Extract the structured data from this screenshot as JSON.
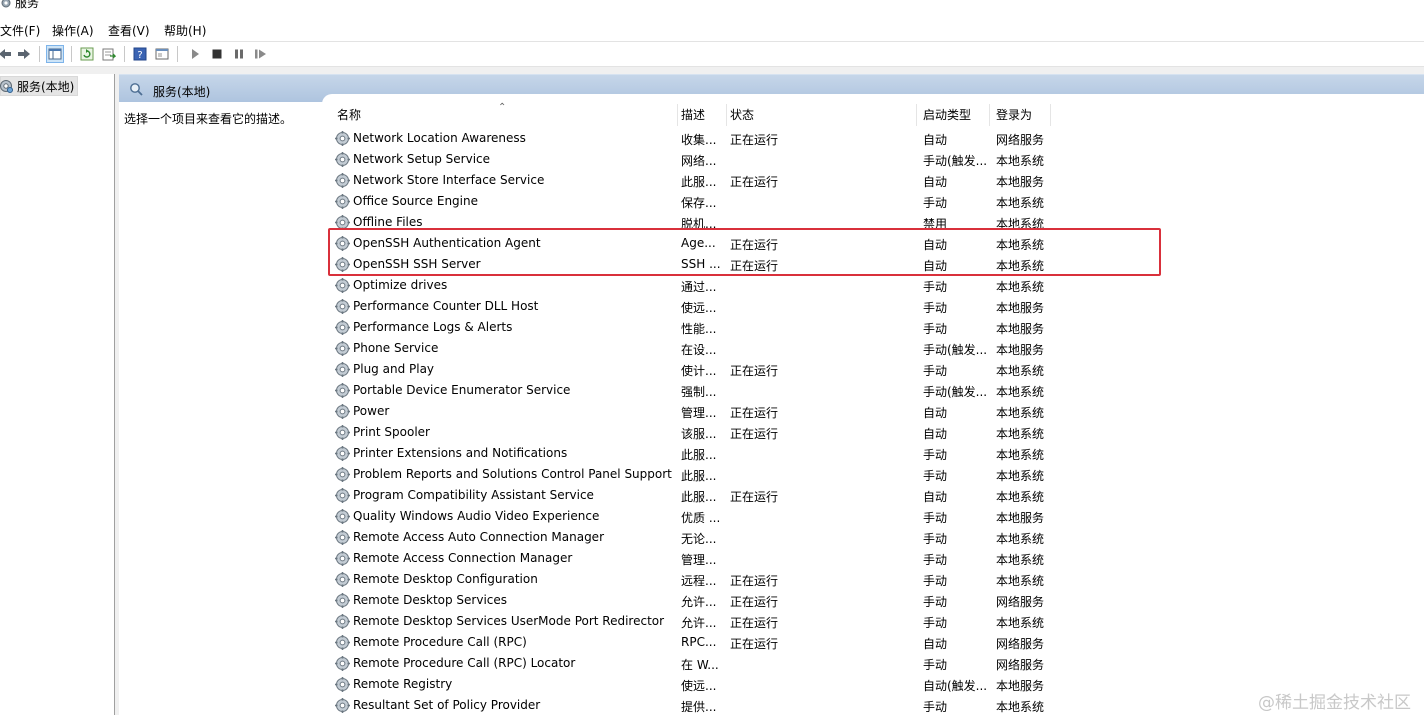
{
  "window": {
    "title": "服务"
  },
  "menu": {
    "items": [
      "文件(F)",
      "操作(A)",
      "查看(V)",
      "帮助(H)"
    ]
  },
  "tree": {
    "root_label": "服务(本地)"
  },
  "detail": {
    "header_title": "服务(本地)",
    "description_prompt": "选择一个项目来查看它的描述。"
  },
  "columns": {
    "name": "名称",
    "description": "描述",
    "status": "状态",
    "startup_type": "启动类型",
    "log_on_as": "登录为"
  },
  "services": [
    {
      "name": "Network Location Awareness",
      "description": "收集...",
      "status": "正在运行",
      "startup": "自动",
      "logon": "网络服务"
    },
    {
      "name": "Network Setup Service",
      "description": "网络...",
      "status": "",
      "startup": "手动(触发...",
      "logon": "本地系统"
    },
    {
      "name": "Network Store Interface Service",
      "description": "此服...",
      "status": "正在运行",
      "startup": "自动",
      "logon": "本地服务"
    },
    {
      "name": "Office  Source Engine",
      "description": "保存...",
      "status": "",
      "startup": "手动",
      "logon": "本地系统"
    },
    {
      "name": "Offline Files",
      "description": "脱机...",
      "status": "",
      "startup": "禁用",
      "logon": "本地系统"
    },
    {
      "name": "OpenSSH Authentication Agent",
      "description": "Age...",
      "status": "正在运行",
      "startup": "自动",
      "logon": "本地系统"
    },
    {
      "name": "OpenSSH SSH Server",
      "description": "SSH ...",
      "status": "正在运行",
      "startup": "自动",
      "logon": "本地系统"
    },
    {
      "name": "Optimize drives",
      "description": "通过...",
      "status": "",
      "startup": "手动",
      "logon": "本地系统"
    },
    {
      "name": "Performance Counter DLL Host",
      "description": "使远...",
      "status": "",
      "startup": "手动",
      "logon": "本地服务"
    },
    {
      "name": "Performance Logs & Alerts",
      "description": "性能...",
      "status": "",
      "startup": "手动",
      "logon": "本地服务"
    },
    {
      "name": "Phone Service",
      "description": "在设...",
      "status": "",
      "startup": "手动(触发...",
      "logon": "本地服务"
    },
    {
      "name": "Plug and Play",
      "description": "使计...",
      "status": "正在运行",
      "startup": "手动",
      "logon": "本地系统"
    },
    {
      "name": "Portable Device Enumerator Service",
      "description": "强制...",
      "status": "",
      "startup": "手动(触发...",
      "logon": "本地系统"
    },
    {
      "name": "Power",
      "description": "管理...",
      "status": "正在运行",
      "startup": "自动",
      "logon": "本地系统"
    },
    {
      "name": "Print Spooler",
      "description": "该服...",
      "status": "正在运行",
      "startup": "自动",
      "logon": "本地系统"
    },
    {
      "name": "Printer Extensions and Notifications",
      "description": "此服...",
      "status": "",
      "startup": "手动",
      "logon": "本地系统"
    },
    {
      "name": "Problem Reports and Solutions Control Panel Support",
      "description": "此服...",
      "status": "",
      "startup": "手动",
      "logon": "本地系统"
    },
    {
      "name": "Program Compatibility Assistant Service",
      "description": "此服...",
      "status": "正在运行",
      "startup": "自动",
      "logon": "本地系统"
    },
    {
      "name": "Quality Windows Audio Video Experience",
      "description": "优质 ...",
      "status": "",
      "startup": "手动",
      "logon": "本地服务"
    },
    {
      "name": "Remote Access Auto Connection Manager",
      "description": "无论...",
      "status": "",
      "startup": "手动",
      "logon": "本地系统"
    },
    {
      "name": "Remote Access Connection Manager",
      "description": "管理...",
      "status": "",
      "startup": "手动",
      "logon": "本地系统"
    },
    {
      "name": "Remote Desktop Configuration",
      "description": "远程...",
      "status": "正在运行",
      "startup": "手动",
      "logon": "本地系统"
    },
    {
      "name": "Remote Desktop Services",
      "description": "允许...",
      "status": "正在运行",
      "startup": "手动",
      "logon": "网络服务"
    },
    {
      "name": "Remote Desktop Services UserMode Port Redirector",
      "description": "允许...",
      "status": "正在运行",
      "startup": "手动",
      "logon": "本地系统"
    },
    {
      "name": "Remote Procedure Call (RPC)",
      "description": "RPC...",
      "status": "正在运行",
      "startup": "自动",
      "logon": "网络服务"
    },
    {
      "name": "Remote Procedure Call (RPC) Locator",
      "description": "在 W...",
      "status": "",
      "startup": "手动",
      "logon": "网络服务"
    },
    {
      "name": "Remote Registry",
      "description": "使远...",
      "status": "",
      "startup": "自动(触发...",
      "logon": "本地服务"
    },
    {
      "name": "Resultant Set of Policy Provider",
      "description": "提供...",
      "status": "",
      "startup": "手动",
      "logon": "本地系统"
    }
  ],
  "highlight_color": "#d9303b",
  "watermark": "@稀土掘金技术社区",
  "icons": [
    "gear-icon",
    "back-arrow-icon",
    "forward-arrow-icon",
    "show-tree-icon",
    "refresh-icon",
    "export-list-icon",
    "help-icon",
    "properties-icon",
    "start-icon",
    "stop-icon",
    "pause-icon",
    "restart-icon"
  ]
}
